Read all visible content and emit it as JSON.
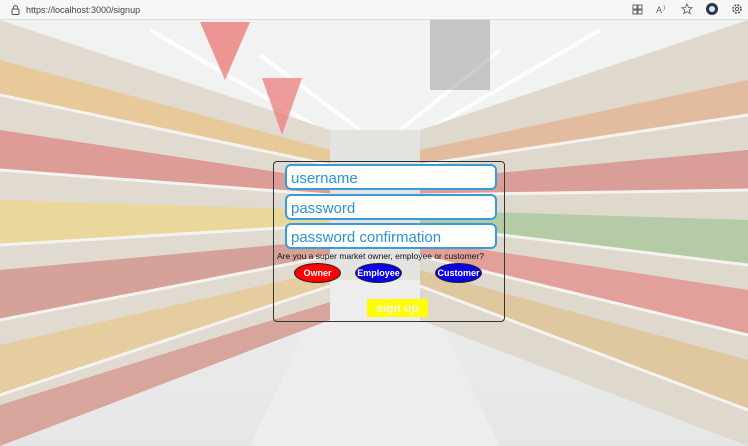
{
  "browser": {
    "url": "https://localhost:3000/signup",
    "icons": [
      "lock-icon",
      "grid-icon",
      "read-aloud-icon",
      "favorite-star-icon",
      "profile-icon",
      "settings-icon"
    ]
  },
  "form": {
    "username_placeholder": "username",
    "password_placeholder": "password",
    "password_confirmation_placeholder": "password confirmation",
    "role_question": "Are you a super market owner, employee or customer?",
    "roles": {
      "owner": "Owner",
      "employee": "Employee",
      "customer": "Customer"
    },
    "submit_label": "sign up"
  },
  "colors": {
    "field_border": "#3b9bd6",
    "owner": "#ff0000",
    "employee": "#0a00e0",
    "customer": "#0a00e0",
    "submit_bg": "#ffff00"
  }
}
